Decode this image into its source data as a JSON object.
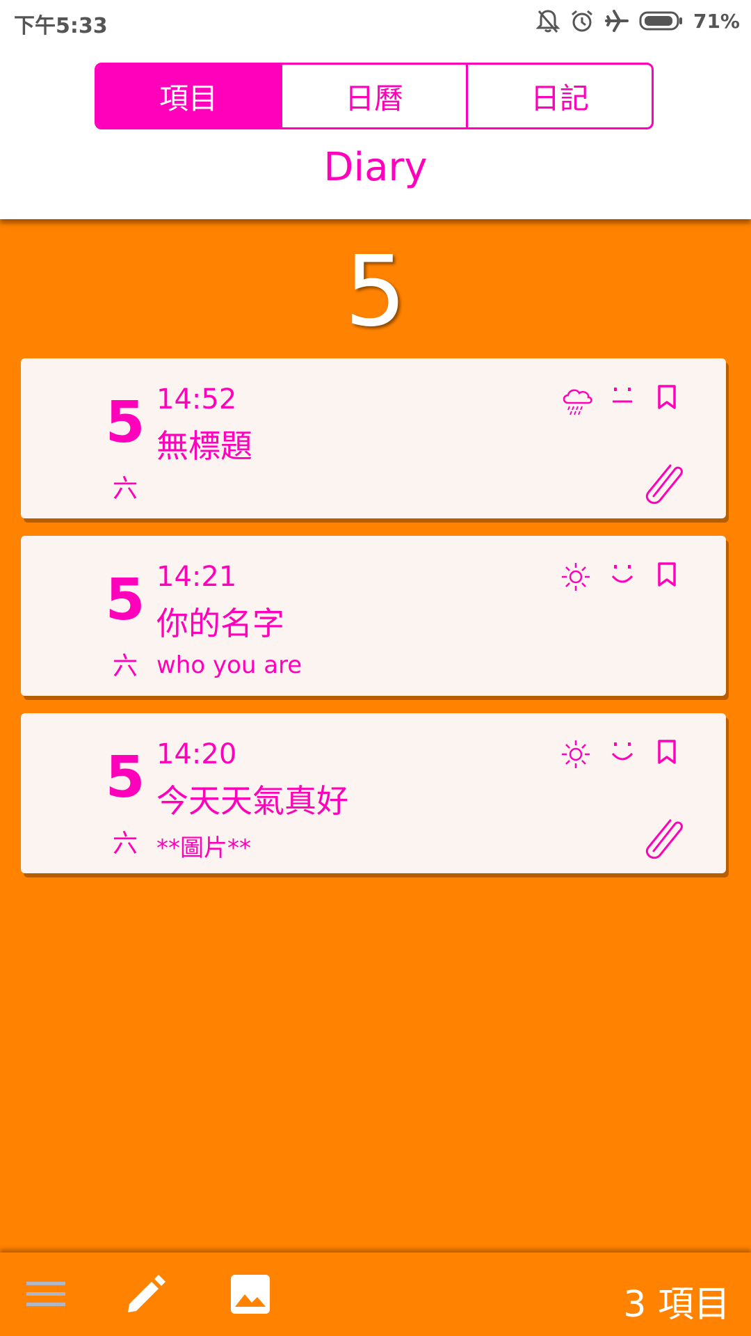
{
  "status_bar": {
    "time": "下午5:33",
    "battery": "71%"
  },
  "tabs": [
    {
      "label": "項目",
      "active": true
    },
    {
      "label": "日曆",
      "active": false
    },
    {
      "label": "日記",
      "active": false
    }
  ],
  "title": "Diary",
  "month": "5",
  "entries": [
    {
      "day": "5",
      "weekday": "六",
      "time": "14:52",
      "title": "無標題",
      "preview": "",
      "weather": "rain-cloud-icon",
      "mood": "neutral-face-icon",
      "bookmark": "bookmark-icon",
      "attachment": true
    },
    {
      "day": "5",
      "weekday": "六",
      "time": "14:21",
      "title": "你的名字",
      "preview": "who you are",
      "weather": "sun-icon",
      "mood": "smile-face-icon",
      "bookmark": "bookmark-icon",
      "attachment": false
    },
    {
      "day": "5",
      "weekday": "六",
      "time": "14:20",
      "title": "今天天氣真好",
      "preview": "**圖片**",
      "weather": "sun-icon",
      "mood": "smile-face-icon",
      "bookmark": "bookmark-icon",
      "attachment": true
    }
  ],
  "bottom_bar": {
    "icons": [
      "menu-icon",
      "edit-icon",
      "photo-icon"
    ],
    "count_label": "3 項目"
  },
  "colors": {
    "accent": "#FF00BB",
    "background": "#FF8200",
    "card": "#FCF4F0"
  }
}
